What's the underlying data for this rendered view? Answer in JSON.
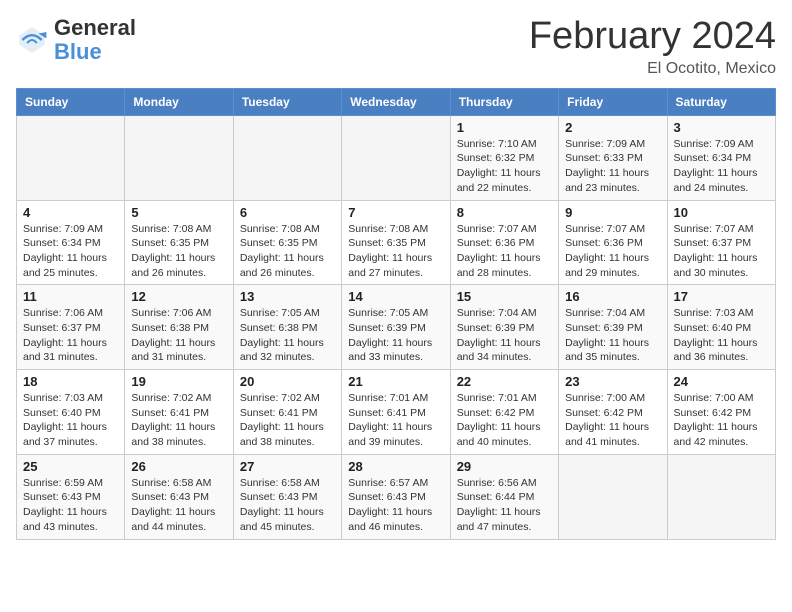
{
  "header": {
    "logo_general": "General",
    "logo_blue": "Blue",
    "month_year": "February 2024",
    "location": "El Ocotito, Mexico"
  },
  "weekdays": [
    "Sunday",
    "Monday",
    "Tuesday",
    "Wednesday",
    "Thursday",
    "Friday",
    "Saturday"
  ],
  "weeks": [
    [
      {
        "day": "",
        "info": ""
      },
      {
        "day": "",
        "info": ""
      },
      {
        "day": "",
        "info": ""
      },
      {
        "day": "",
        "info": ""
      },
      {
        "day": "1",
        "info": "Sunrise: 7:10 AM\nSunset: 6:32 PM\nDaylight: 11 hours\nand 22 minutes."
      },
      {
        "day": "2",
        "info": "Sunrise: 7:09 AM\nSunset: 6:33 PM\nDaylight: 11 hours\nand 23 minutes."
      },
      {
        "day": "3",
        "info": "Sunrise: 7:09 AM\nSunset: 6:34 PM\nDaylight: 11 hours\nand 24 minutes."
      }
    ],
    [
      {
        "day": "4",
        "info": "Sunrise: 7:09 AM\nSunset: 6:34 PM\nDaylight: 11 hours\nand 25 minutes."
      },
      {
        "day": "5",
        "info": "Sunrise: 7:08 AM\nSunset: 6:35 PM\nDaylight: 11 hours\nand 26 minutes."
      },
      {
        "day": "6",
        "info": "Sunrise: 7:08 AM\nSunset: 6:35 PM\nDaylight: 11 hours\nand 26 minutes."
      },
      {
        "day": "7",
        "info": "Sunrise: 7:08 AM\nSunset: 6:35 PM\nDaylight: 11 hours\nand 27 minutes."
      },
      {
        "day": "8",
        "info": "Sunrise: 7:07 AM\nSunset: 6:36 PM\nDaylight: 11 hours\nand 28 minutes."
      },
      {
        "day": "9",
        "info": "Sunrise: 7:07 AM\nSunset: 6:36 PM\nDaylight: 11 hours\nand 29 minutes."
      },
      {
        "day": "10",
        "info": "Sunrise: 7:07 AM\nSunset: 6:37 PM\nDaylight: 11 hours\nand 30 minutes."
      }
    ],
    [
      {
        "day": "11",
        "info": "Sunrise: 7:06 AM\nSunset: 6:37 PM\nDaylight: 11 hours\nand 31 minutes."
      },
      {
        "day": "12",
        "info": "Sunrise: 7:06 AM\nSunset: 6:38 PM\nDaylight: 11 hours\nand 31 minutes."
      },
      {
        "day": "13",
        "info": "Sunrise: 7:05 AM\nSunset: 6:38 PM\nDaylight: 11 hours\nand 32 minutes."
      },
      {
        "day": "14",
        "info": "Sunrise: 7:05 AM\nSunset: 6:39 PM\nDaylight: 11 hours\nand 33 minutes."
      },
      {
        "day": "15",
        "info": "Sunrise: 7:04 AM\nSunset: 6:39 PM\nDaylight: 11 hours\nand 34 minutes."
      },
      {
        "day": "16",
        "info": "Sunrise: 7:04 AM\nSunset: 6:39 PM\nDaylight: 11 hours\nand 35 minutes."
      },
      {
        "day": "17",
        "info": "Sunrise: 7:03 AM\nSunset: 6:40 PM\nDaylight: 11 hours\nand 36 minutes."
      }
    ],
    [
      {
        "day": "18",
        "info": "Sunrise: 7:03 AM\nSunset: 6:40 PM\nDaylight: 11 hours\nand 37 minutes."
      },
      {
        "day": "19",
        "info": "Sunrise: 7:02 AM\nSunset: 6:41 PM\nDaylight: 11 hours\nand 38 minutes."
      },
      {
        "day": "20",
        "info": "Sunrise: 7:02 AM\nSunset: 6:41 PM\nDaylight: 11 hours\nand 38 minutes."
      },
      {
        "day": "21",
        "info": "Sunrise: 7:01 AM\nSunset: 6:41 PM\nDaylight: 11 hours\nand 39 minutes."
      },
      {
        "day": "22",
        "info": "Sunrise: 7:01 AM\nSunset: 6:42 PM\nDaylight: 11 hours\nand 40 minutes."
      },
      {
        "day": "23",
        "info": "Sunrise: 7:00 AM\nSunset: 6:42 PM\nDaylight: 11 hours\nand 41 minutes."
      },
      {
        "day": "24",
        "info": "Sunrise: 7:00 AM\nSunset: 6:42 PM\nDaylight: 11 hours\nand 42 minutes."
      }
    ],
    [
      {
        "day": "25",
        "info": "Sunrise: 6:59 AM\nSunset: 6:43 PM\nDaylight: 11 hours\nand 43 minutes."
      },
      {
        "day": "26",
        "info": "Sunrise: 6:58 AM\nSunset: 6:43 PM\nDaylight: 11 hours\nand 44 minutes."
      },
      {
        "day": "27",
        "info": "Sunrise: 6:58 AM\nSunset: 6:43 PM\nDaylight: 11 hours\nand 45 minutes."
      },
      {
        "day": "28",
        "info": "Sunrise: 6:57 AM\nSunset: 6:43 PM\nDaylight: 11 hours\nand 46 minutes."
      },
      {
        "day": "29",
        "info": "Sunrise: 6:56 AM\nSunset: 6:44 PM\nDaylight: 11 hours\nand 47 minutes."
      },
      {
        "day": "",
        "info": ""
      },
      {
        "day": "",
        "info": ""
      }
    ]
  ]
}
